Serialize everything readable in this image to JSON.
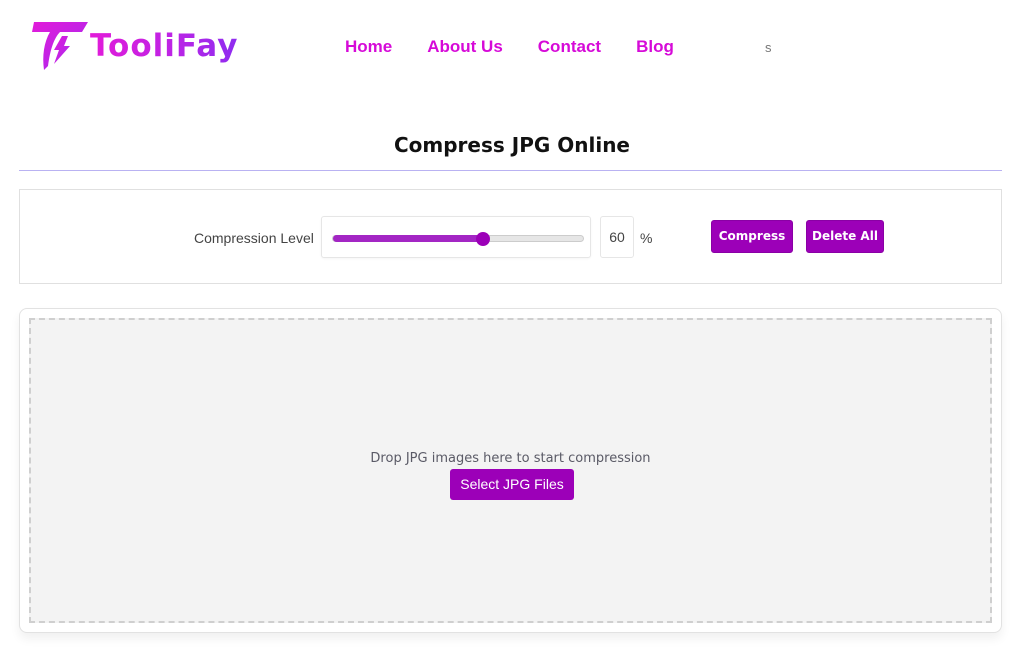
{
  "header": {
    "logo_icon": "tooli-lightning-t-logo",
    "logo_text": "TooliFay",
    "nav": [
      {
        "label": "Home"
      },
      {
        "label": "About Us"
      },
      {
        "label": "Contact"
      },
      {
        "label": "Blog"
      }
    ],
    "nav_extra": "s"
  },
  "page": {
    "title": "Compress JPG Online"
  },
  "controls": {
    "compression_label": "Compression Level",
    "compression_value": 60,
    "compression_value_text": "60",
    "unit": "%",
    "compress_button": "Compress",
    "delete_all_button": "Delete All"
  },
  "dropzone": {
    "instruction": "Drop JPG images here to start compression",
    "select_button": "Select JPG Files"
  },
  "colors": {
    "brand": "#9c00b8",
    "nav_link": "#d60ad8",
    "title_rule": "#b9b2f2"
  }
}
